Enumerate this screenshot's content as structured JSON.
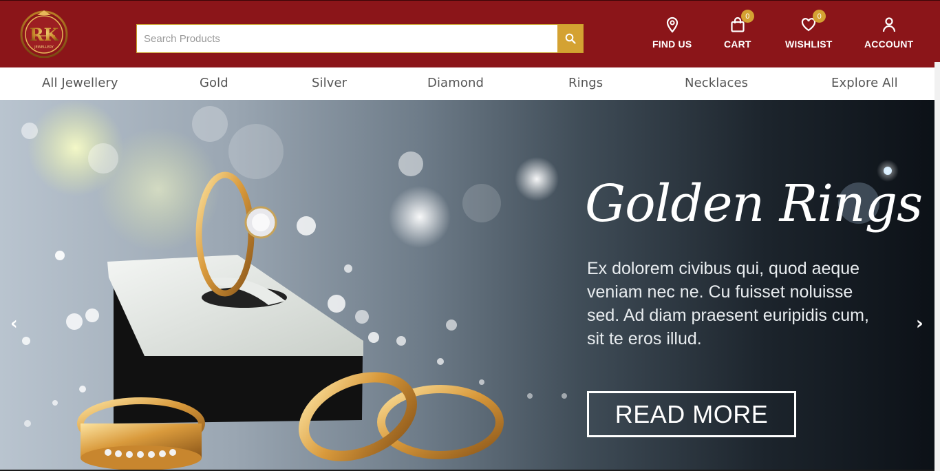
{
  "brand": {
    "logo_monogram": "RK",
    "logo_subtext": "JEWELLERY",
    "primary_color": "#8b1519",
    "accent_color": "#d4a232"
  },
  "search": {
    "placeholder": "Search Products",
    "value": "",
    "button_icon": "search-icon"
  },
  "header_nav": {
    "find_us": {
      "label": "FIND US",
      "icon": "map-pin-icon"
    },
    "cart": {
      "label": "CART",
      "icon": "shopping-bag-icon",
      "count": "0"
    },
    "wishlist": {
      "label": "WISHLIST",
      "icon": "heart-icon",
      "count": "0"
    },
    "account": {
      "label": "ACCOUNT",
      "icon": "user-icon"
    }
  },
  "categories": [
    "All Jewellery",
    "Gold",
    "Silver",
    "Diamond",
    "Rings",
    "Necklaces",
    "Explore All"
  ],
  "hero": {
    "title": "Golden Rings",
    "text": "Ex dolorem civibus qui, quod aeque veniam nec ne. Cu fuisset noluisse sed. Ad diam praesent euripidis cum, sit te eros illud.",
    "cta": "READ MORE",
    "prev_arrow": "‹",
    "next_arrow": "›"
  }
}
